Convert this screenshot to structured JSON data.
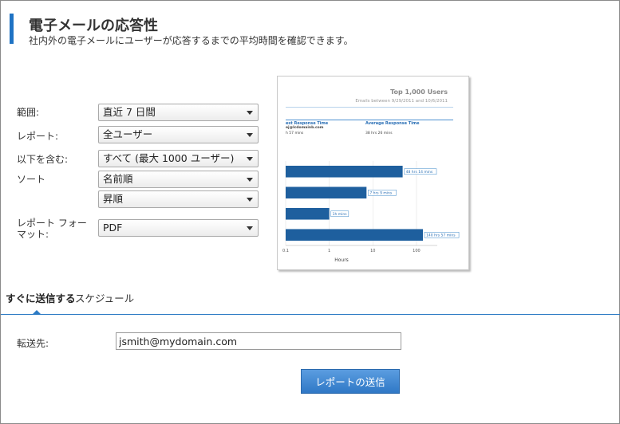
{
  "header": {
    "title": "電子メールの応答性",
    "subtitle": "社内外の電子メールにユーザーが応答するまでの平均時間を確認できます。"
  },
  "form": {
    "range": {
      "label": "範囲:",
      "value": "直近 7 日間"
    },
    "report": {
      "label": "レポート:",
      "value": "全ユーザー"
    },
    "include": {
      "label": "以下を含む:",
      "value": "すべて (最大 1000 ユーザー)"
    },
    "sort": {
      "label": "ソート",
      "value": "名前順"
    },
    "order": {
      "value": "昇順"
    },
    "format": {
      "label": "レポート フォーマット:",
      "value": "PDF"
    }
  },
  "preview": {
    "title": "Top 1,000 Users",
    "subtitle": "Emails between 9/29/2011 and 10/6/2011",
    "col1_header": "est Response Time",
    "col2_header": "Average Response Time",
    "row1_col1": "ej@lcdomainb.com",
    "row2_col1": "h 57 mins",
    "row2_col2": "38 hrs 26 mins",
    "chart_data": {
      "type": "bar",
      "orientation": "horizontal",
      "x_scale": "log",
      "xlabel": "Hours",
      "x_ticks": [
        "0.1",
        "1",
        "10",
        "100"
      ],
      "xlim": [
        0.1,
        300
      ],
      "grid": true,
      "values": [
        48.2,
        7.15,
        1.0,
        140.95
      ],
      "data_labels": [
        "48 hrs 14 mins",
        "7 hrs 9 mins",
        "1h mins",
        "140 hrs 57 mins"
      ]
    }
  },
  "tabs": {
    "now": "すぐに送信する",
    "schedule": "スケジュール"
  },
  "forward": {
    "label": "転送先:",
    "value": "jsmith@mydomain.com"
  },
  "send_button": "レポートの送信",
  "colors": {
    "accent": "#1f73c4",
    "bar": "#1e5f9e",
    "button": "#3a83cf"
  }
}
